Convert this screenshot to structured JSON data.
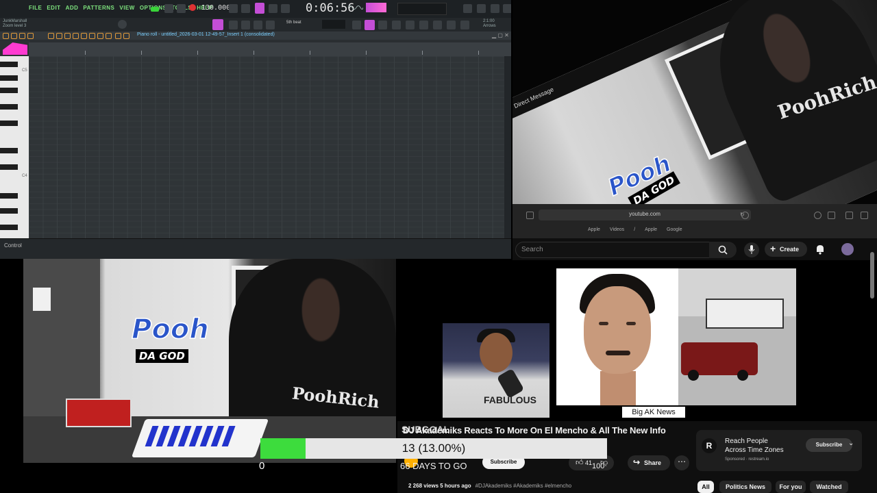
{
  "fl_studio": {
    "menu": [
      "FILE",
      "EDIT",
      "ADD",
      "PATTERNS",
      "VIEW",
      "OPTIONS",
      "TOOLS",
      "HELP"
    ],
    "bpm": "130.000",
    "time": "0:06:56",
    "hint_line1": "JunkMarshall",
    "hint_line2": "Zoom level 3",
    "pattern": "5th beat",
    "arrow_line1": "2:1:00",
    "arrow_line2": "Arrows",
    "piano_roll_title": "Piano roll - untitled_2026-03-01 12-49-57_Insert 1 (consolidated)",
    "c5_label": "C5",
    "c4_label": "C4",
    "control_label": "Control",
    "accent": "#7ee47e",
    "note_color": "#ff3bd1"
  },
  "dm": {
    "header_label": "Direct Message",
    "shirt_text": "PoohRich"
  },
  "browser": {
    "url": "youtube.com",
    "bookmarks": [
      "Apple",
      "Videos",
      "/",
      "Apple",
      "Google"
    ]
  },
  "youtube": {
    "search_placeholder": "Search",
    "create_label": "Create",
    "search_icon": "search-icon",
    "mic_icon": "mic-icon",
    "bell_icon": "bell-icon",
    "video_title": "DJ Akademiks Reacts To More On El Mencho & All The New Info",
    "title_overlap": "SUBGOAL",
    "thumbnail_label": "Big AK News",
    "thumb_shirt_text": "FABULOUS",
    "days_to_go": "66 DAYS TO GO",
    "subscribe_label": "Subscribe",
    "likes": "41",
    "dislike_count": "100",
    "share_label": "Share",
    "views_line": "2 268 views  5 hours ago",
    "tags_line": "#DJAkademiks #Akademiks #elmencho",
    "ad": {
      "logo_letter": "R",
      "title": "Reach People Across Time Zones",
      "sponsored": "Sponsored · restream.io",
      "subscribe_label": "Subscribe"
    },
    "chips": [
      "All",
      "Politics News",
      "For you",
      "Watched"
    ]
  },
  "webcam": {
    "logo_main": "Pooh",
    "logo_sub": "DA GOD",
    "shirt_text": "PoohRich"
  },
  "progress": {
    "label": "13 (13.00%)",
    "fraction": 0.13,
    "start_label": "0",
    "fill_color": "#3ddc3d"
  }
}
